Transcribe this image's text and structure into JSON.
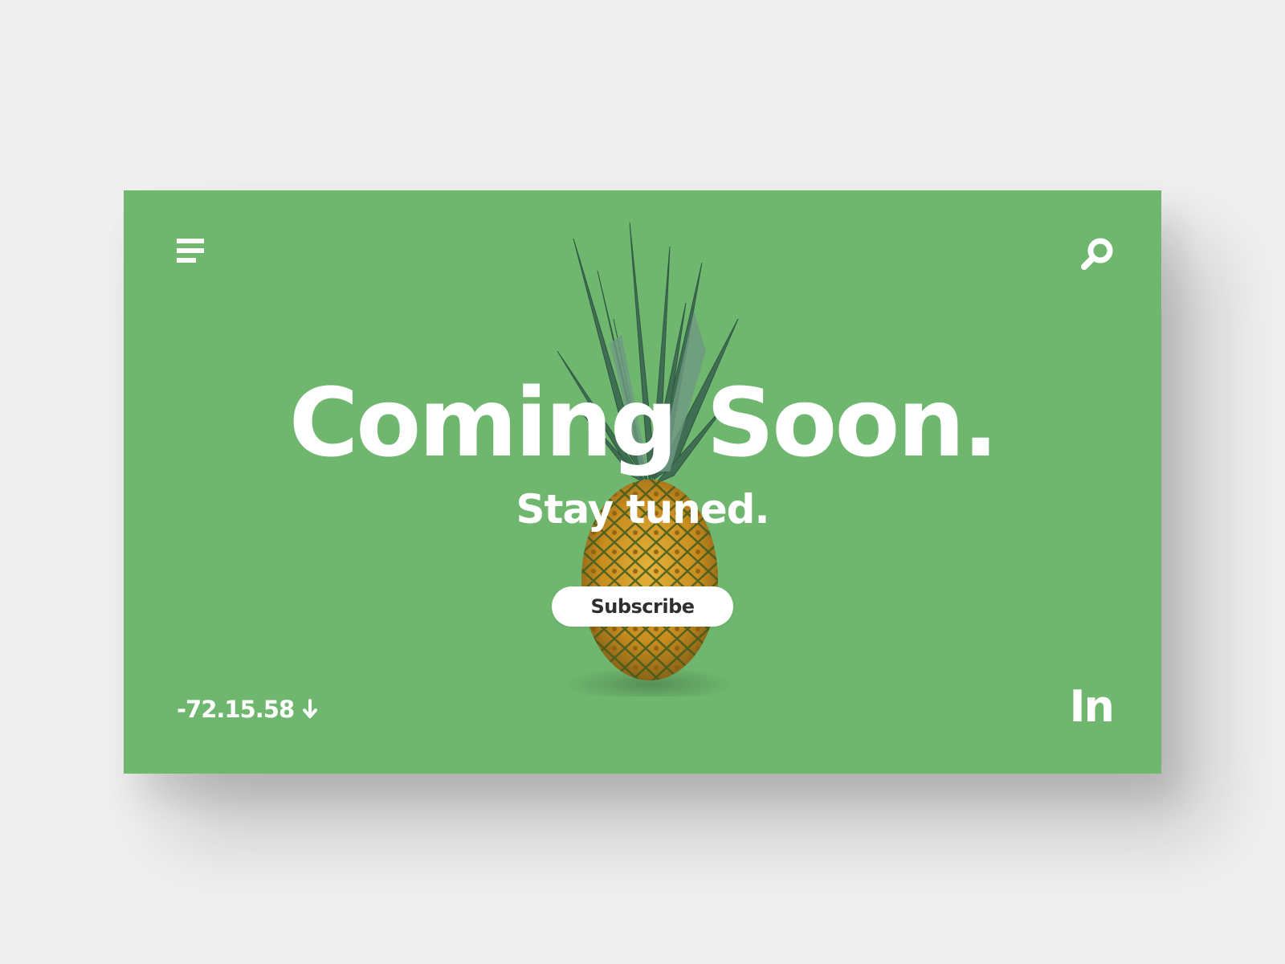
{
  "hero": {
    "headline": "Coming Soon.",
    "subheadline": "Stay tuned.",
    "subscribe_label": "Subscribe"
  },
  "footer": {
    "coordinates": "-72.15.58",
    "social_logo_text": "In"
  },
  "icons": {
    "menu": "menu-icon",
    "search": "search-icon",
    "arrow": "arrow-down-icon",
    "social": "linkedin-icon"
  },
  "colors": {
    "page_background": "#efefef",
    "card_background": "#6fb76f",
    "text": "#ffffff",
    "button_background": "#ffffff",
    "button_text": "#2f2f2f"
  }
}
